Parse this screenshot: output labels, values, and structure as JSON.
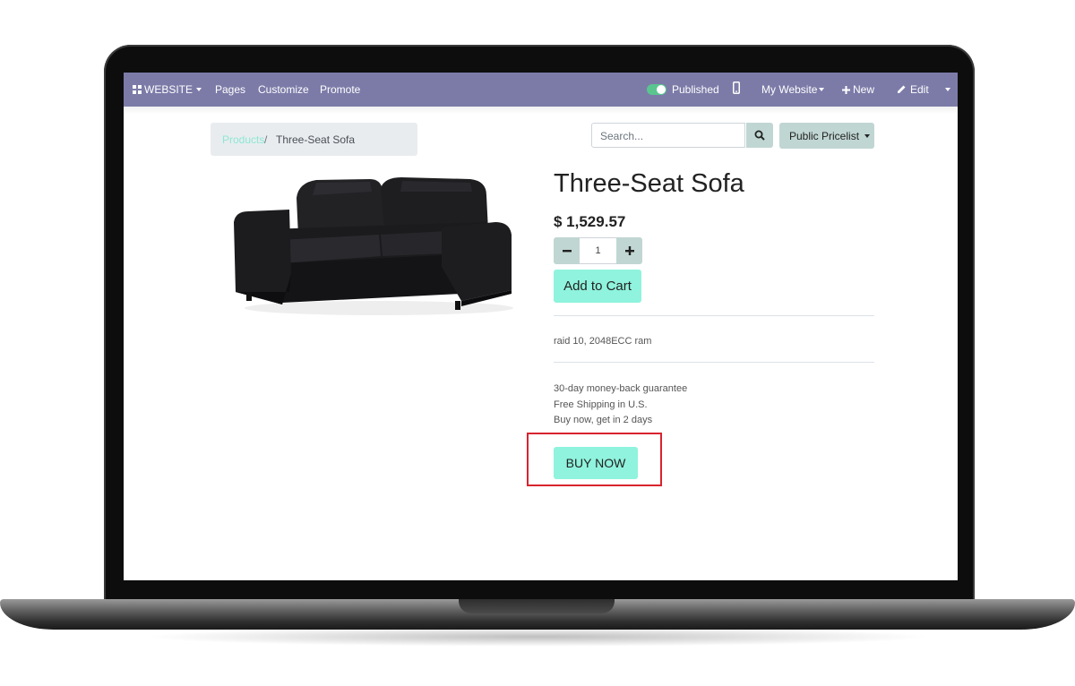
{
  "navbar": {
    "website_label": "WEBSITE",
    "pages_label": "Pages",
    "customize_label": "Customize",
    "promote_label": "Promote",
    "published_label": "Published",
    "published_toggle_on": true,
    "my_website_label": "My Website",
    "new_label": "New",
    "edit_label": "Edit",
    "bg_color": "#7c7ba8"
  },
  "breadcrumb": {
    "link_label": "Products",
    "separator": "/",
    "current_label": "Three-Seat Sofa"
  },
  "search": {
    "placeholder": "Search..."
  },
  "pricelist": {
    "label": "Public Pricelist"
  },
  "product": {
    "title": "Three-Seat Sofa",
    "price": "$ 1,529.57",
    "quantity": "1",
    "add_to_cart_label": "Add to Cart",
    "description": "raid 10, 2048ECC ram",
    "guarantees": [
      "30-day money-back guarantee",
      "Free Shipping in U.S.",
      "Buy now, get in 2 days"
    ],
    "buy_now_label": "BUY NOW"
  },
  "colors": {
    "accent_button": "#8ff3dd",
    "secondary_button": "#c0d6d3",
    "highlight_border": "#d8242e"
  }
}
